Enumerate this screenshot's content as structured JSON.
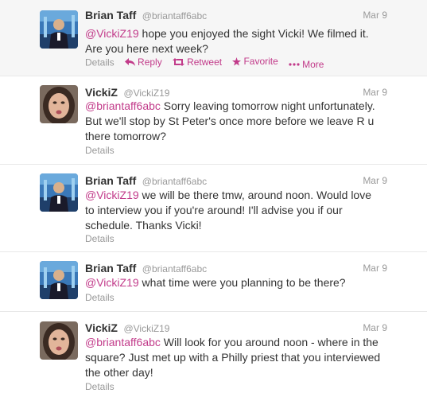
{
  "tweets": [
    {
      "name": "Brian Taff",
      "handle": "@briantaff6abc",
      "time": "Mar 9",
      "mention": "@VickiZ19",
      "text_lines": [
        " hope you enjoyed the sight Vicki! We filmed it.",
        "Are you here next week?"
      ],
      "details": "Details",
      "actions": {
        "reply": "Reply",
        "retweet": "Retweet",
        "favorite": "Favorite",
        "more": "More"
      }
    },
    {
      "name": "VickiZ",
      "handle": "@VickiZ19",
      "time": "Mar 9",
      "mention": "@briantaff6abc",
      "text_lines": [
        " Sorry leaving tomorrow night unfortunately.",
        "But we'll stop by St Peter's once more before we leave R u",
        "there tomorrow?"
      ],
      "details": "Details"
    },
    {
      "name": "Brian Taff",
      "handle": "@briantaff6abc",
      "time": "Mar 9",
      "mention": "@VickiZ19",
      "text_lines": [
        " we will be there tmw, around noon. Would love",
        "to interview you if you're around! I'll advise you if our",
        "schedule. Thanks Vicki!"
      ],
      "details": "Details"
    },
    {
      "name": "Brian Taff",
      "handle": "@briantaff6abc",
      "time": "Mar 9",
      "mention": "@VickiZ19",
      "text_lines": [
        " what time were you planning to be there?"
      ],
      "details": "Details"
    },
    {
      "name": "VickiZ",
      "handle": "@VickiZ19",
      "time": "Mar 9",
      "mention": "@briantaff6abc",
      "text_lines": [
        " Will look for you around noon - where in the",
        "square? Just met up with a Philly priest that you interviewed",
        "the other day!"
      ],
      "details": "Details"
    }
  ],
  "colors": {
    "link": "#c23b8a",
    "muted": "#999999",
    "text": "#333333",
    "divider": "#e8e8e8"
  }
}
